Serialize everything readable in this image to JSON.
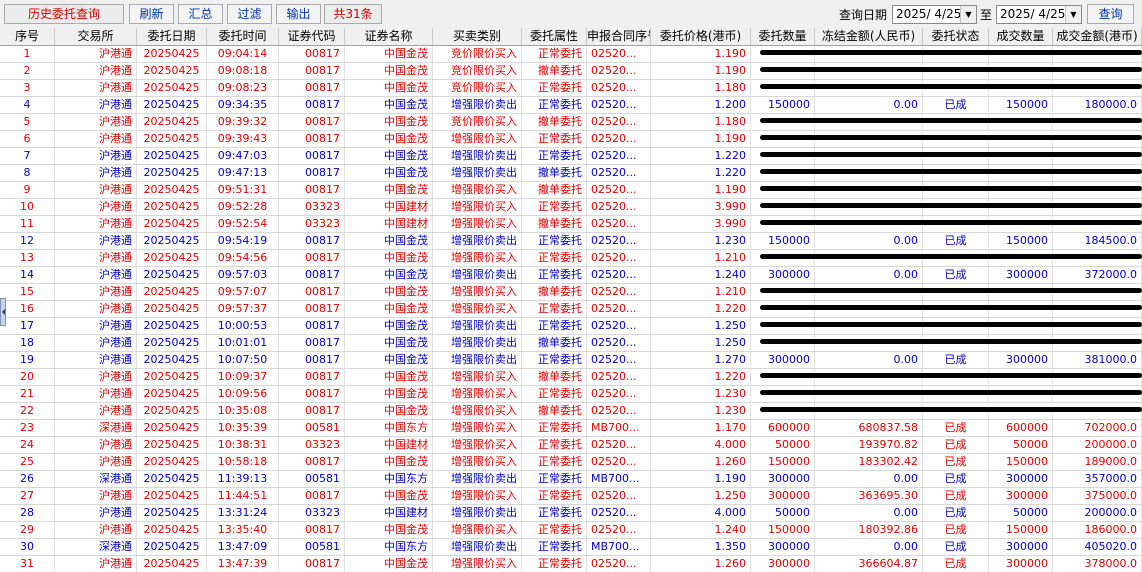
{
  "toolbar": {
    "title": "历史委托查询",
    "refresh_label": "刷新",
    "summary_label": "汇总",
    "filter_label": "过滤",
    "export_label": "输出",
    "count_label": "共31条",
    "query_date_label": "查询日期",
    "start_date": "2025/ 4/25",
    "to_label": "至",
    "end_date": "2025/ 4/25",
    "query_label": "查询"
  },
  "table": {
    "headers": [
      "序号",
      "交易所",
      "委托日期",
      "委托时间",
      "证券代码",
      "证券名称",
      "买卖类别",
      "委托属性",
      "申报合同序号",
      "委托价格(港币)",
      "委托数量",
      "冻结金额(人民币)",
      "委托状态",
      "成交数量",
      "成交金额(港币)"
    ],
    "rows": [
      {
        "c": [
          "1",
          "沪港通",
          "20250425",
          "09:04:14",
          "00817",
          "中国金茂",
          "竞价限价买入",
          "正常委托",
          "02520...",
          "1.190",
          "",
          "",
          "",
          "",
          ""
        ],
        "color": "red",
        "redacted": true
      },
      {
        "c": [
          "2",
          "沪港通",
          "20250425",
          "09:08:18",
          "00817",
          "中国金茂",
          "竞价限价买入",
          "撤单委托",
          "02520...",
          "1.190",
          "",
          "",
          "",
          "",
          ""
        ],
        "color": "red",
        "redacted": true
      },
      {
        "c": [
          "3",
          "沪港通",
          "20250425",
          "09:08:23",
          "00817",
          "中国金茂",
          "竞价限价买入",
          "正常委托",
          "02520...",
          "1.180",
          "",
          "",
          "",
          "",
          ""
        ],
        "color": "red",
        "redacted": true
      },
      {
        "c": [
          "4",
          "沪港通",
          "20250425",
          "09:34:35",
          "00817",
          "中国金茂",
          "增强限价卖出",
          "正常委托",
          "02520...",
          "1.200",
          "150000",
          "0.00",
          "已成",
          "150000",
          "180000.0"
        ],
        "color": "blue",
        "redacted": false
      },
      {
        "c": [
          "5",
          "沪港通",
          "20250425",
          "09:39:32",
          "00817",
          "中国金茂",
          "竞价限价买入",
          "撤单委托",
          "02520...",
          "1.180",
          "",
          "",
          "",
          "",
          ""
        ],
        "color": "red",
        "redacted": true
      },
      {
        "c": [
          "6",
          "沪港通",
          "20250425",
          "09:39:43",
          "00817",
          "中国金茂",
          "增强限价买入",
          "正常委托",
          "02520...",
          "1.190",
          "",
          "",
          "",
          "",
          ""
        ],
        "color": "red",
        "redacted": true
      },
      {
        "c": [
          "7",
          "沪港通",
          "20250425",
          "09:47:03",
          "00817",
          "中国金茂",
          "增强限价卖出",
          "正常委托",
          "02520...",
          "1.220",
          "",
          "",
          "",
          "",
          ""
        ],
        "color": "blue",
        "redacted": true
      },
      {
        "c": [
          "8",
          "沪港通",
          "20250425",
          "09:47:13",
          "00817",
          "中国金茂",
          "增强限价卖出",
          "撤单委托",
          "02520...",
          "1.220",
          "",
          "",
          "",
          "",
          ""
        ],
        "color": "blue",
        "redacted": true
      },
      {
        "c": [
          "9",
          "沪港通",
          "20250425",
          "09:51:31",
          "00817",
          "中国金茂",
          "增强限价买入",
          "撤单委托",
          "02520...",
          "1.190",
          "",
          "",
          "",
          "",
          ""
        ],
        "color": "red",
        "redacted": true
      },
      {
        "c": [
          "10",
          "沪港通",
          "20250425",
          "09:52:28",
          "03323",
          "中国建材",
          "增强限价买入",
          "正常委托",
          "02520...",
          "3.990",
          "",
          "",
          "",
          "",
          ""
        ],
        "color": "red",
        "redacted": true
      },
      {
        "c": [
          "11",
          "沪港通",
          "20250425",
          "09:52:54",
          "03323",
          "中国建材",
          "增强限价买入",
          "撤单委托",
          "02520...",
          "3.990",
          "",
          "",
          "",
          "",
          ""
        ],
        "color": "red",
        "redacted": true
      },
      {
        "c": [
          "12",
          "沪港通",
          "20250425",
          "09:54:19",
          "00817",
          "中国金茂",
          "增强限价卖出",
          "正常委托",
          "02520...",
          "1.230",
          "150000",
          "0.00",
          "已成",
          "150000",
          "184500.0"
        ],
        "color": "blue",
        "redacted": false
      },
      {
        "c": [
          "13",
          "沪港通",
          "20250425",
          "09:54:56",
          "00817",
          "中国金茂",
          "增强限价买入",
          "正常委托",
          "02520...",
          "1.210",
          "",
          "",
          "",
          "",
          ""
        ],
        "color": "red",
        "redacted": true
      },
      {
        "c": [
          "14",
          "沪港通",
          "20250425",
          "09:57:03",
          "00817",
          "中国金茂",
          "增强限价卖出",
          "正常委托",
          "02520...",
          "1.240",
          "300000",
          "0.00",
          "已成",
          "300000",
          "372000.0"
        ],
        "color": "blue",
        "redacted": false
      },
      {
        "c": [
          "15",
          "沪港通",
          "20250425",
          "09:57:07",
          "00817",
          "中国金茂",
          "增强限价买入",
          "撤单委托",
          "02520...",
          "1.210",
          "",
          "",
          "",
          "",
          ""
        ],
        "color": "red",
        "redacted": true
      },
      {
        "c": [
          "16",
          "沪港通",
          "20250425",
          "09:57:37",
          "00817",
          "中国金茂",
          "增强限价买入",
          "正常委托",
          "02520...",
          "1.220",
          "",
          "",
          "",
          "",
          ""
        ],
        "color": "red",
        "redacted": true
      },
      {
        "c": [
          "17",
          "沪港通",
          "20250425",
          "10:00:53",
          "00817",
          "中国金茂",
          "增强限价卖出",
          "正常委托",
          "02520...",
          "1.250",
          "",
          "",
          "",
          "",
          ""
        ],
        "color": "blue",
        "redacted": true
      },
      {
        "c": [
          "18",
          "沪港通",
          "20250425",
          "10:01:01",
          "00817",
          "中国金茂",
          "增强限价卖出",
          "撤单委托",
          "02520...",
          "1.250",
          "",
          "",
          "",
          "",
          ""
        ],
        "color": "blue",
        "redacted": true
      },
      {
        "c": [
          "19",
          "沪港通",
          "20250425",
          "10:07:50",
          "00817",
          "中国金茂",
          "增强限价卖出",
          "正常委托",
          "02520...",
          "1.270",
          "300000",
          "0.00",
          "已成",
          "300000",
          "381000.0"
        ],
        "color": "blue",
        "redacted": false
      },
      {
        "c": [
          "20",
          "沪港通",
          "20250425",
          "10:09:37",
          "00817",
          "中国金茂",
          "增强限价买入",
          "撤单委托",
          "02520...",
          "1.220",
          "",
          "",
          "",
          "",
          ""
        ],
        "color": "red",
        "redacted": true
      },
      {
        "c": [
          "21",
          "沪港通",
          "20250425",
          "10:09:56",
          "00817",
          "中国金茂",
          "增强限价买入",
          "正常委托",
          "02520...",
          "1.230",
          "",
          "",
          "",
          "",
          ""
        ],
        "color": "red",
        "redacted": true
      },
      {
        "c": [
          "22",
          "沪港通",
          "20250425",
          "10:35:08",
          "00817",
          "中国金茂",
          "增强限价买入",
          "撤单委托",
          "02520...",
          "1.230",
          "",
          "",
          "",
          "",
          ""
        ],
        "color": "red",
        "redacted": true
      },
      {
        "c": [
          "23",
          "深港通",
          "20250425",
          "10:35:39",
          "00581",
          "中国东方",
          "增强限价买入",
          "正常委托",
          "MB700...",
          "1.170",
          "600000",
          "680837.58",
          "已成",
          "600000",
          "702000.0"
        ],
        "color": "red",
        "redacted": false
      },
      {
        "c": [
          "24",
          "沪港通",
          "20250425",
          "10:38:31",
          "03323",
          "中国建材",
          "增强限价买入",
          "正常委托",
          "02520...",
          "4.000",
          "50000",
          "193970.82",
          "已成",
          "50000",
          "200000.0"
        ],
        "color": "red",
        "redacted": false
      },
      {
        "c": [
          "25",
          "沪港通",
          "20250425",
          "10:58:18",
          "00817",
          "中国金茂",
          "增强限价买入",
          "正常委托",
          "02520...",
          "1.260",
          "150000",
          "183302.42",
          "已成",
          "150000",
          "189000.0"
        ],
        "color": "red",
        "redacted": false
      },
      {
        "c": [
          "26",
          "深港通",
          "20250425",
          "11:39:13",
          "00581",
          "中国东方",
          "增强限价卖出",
          "正常委托",
          "MB700...",
          "1.190",
          "300000",
          "0.00",
          "已成",
          "300000",
          "357000.0"
        ],
        "color": "blue",
        "redacted": false
      },
      {
        "c": [
          "27",
          "沪港通",
          "20250425",
          "11:44:51",
          "00817",
          "中国金茂",
          "增强限价买入",
          "正常委托",
          "02520...",
          "1.250",
          "300000",
          "363695.30",
          "已成",
          "300000",
          "375000.0"
        ],
        "color": "red",
        "redacted": false
      },
      {
        "c": [
          "28",
          "沪港通",
          "20250425",
          "13:31:24",
          "03323",
          "中国建材",
          "增强限价卖出",
          "正常委托",
          "02520...",
          "4.000",
          "50000",
          "0.00",
          "已成",
          "50000",
          "200000.0"
        ],
        "color": "blue",
        "redacted": false
      },
      {
        "c": [
          "29",
          "沪港通",
          "20250425",
          "13:35:40",
          "00817",
          "中国金茂",
          "增强限价买入",
          "正常委托",
          "02520...",
          "1.240",
          "150000",
          "180392.86",
          "已成",
          "150000",
          "186000.0"
        ],
        "color": "red",
        "redacted": false
      },
      {
        "c": [
          "30",
          "深港通",
          "20250425",
          "13:47:09",
          "00581",
          "中国东方",
          "增强限价卖出",
          "正常委托",
          "MB700...",
          "1.350",
          "300000",
          "0.00",
          "已成",
          "300000",
          "405020.0"
        ],
        "color": "blue",
        "redacted": false
      },
      {
        "c": [
          "31",
          "沪港通",
          "20250425",
          "13:47:39",
          "00817",
          "中国金茂",
          "增强限价买入",
          "正常委托",
          "02520...",
          "1.260",
          "300000",
          "366604.87",
          "已成",
          "300000",
          "378000.0"
        ],
        "color": "red",
        "redacted": false
      }
    ]
  }
}
